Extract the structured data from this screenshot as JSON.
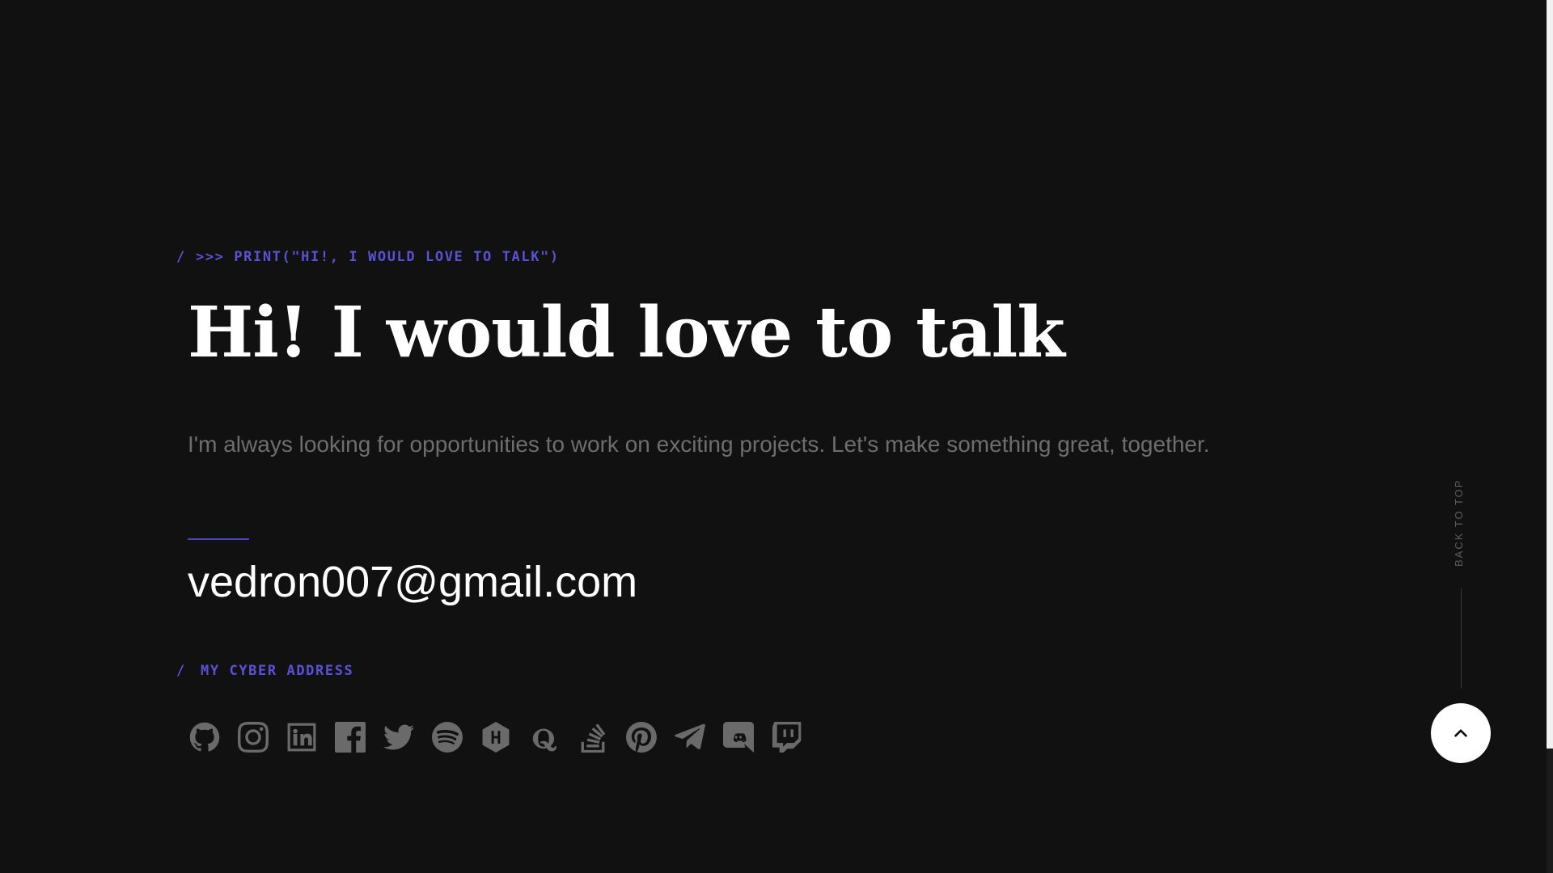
{
  "contact": {
    "eyebrow_slash": "/",
    "eyebrow_text": ">>> PRINT(\"HI!, I WOULD LOVE TO TALK\")",
    "heading": "Hi! I would love to talk",
    "lead": "I'm always looking for opportunities to work on exciting projects. Let's make something great, together.",
    "email": "vedron007@gmail.com"
  },
  "cyber": {
    "slash": "/",
    "label": "MY CYBER ADDRESS",
    "icons": [
      "github-icon",
      "instagram-icon",
      "linkedin-icon",
      "facebook-icon",
      "twitter-icon",
      "spotify-icon",
      "hashnode-icon",
      "quora-icon",
      "stackoverflow-icon",
      "pinterest-icon",
      "telegram-icon",
      "discord-icon",
      "twitch-icon"
    ]
  },
  "back_to_top": {
    "label": "BACK TO TOP",
    "icon": "chevron-up-icon"
  },
  "colors": {
    "background": "#111111",
    "accent": "#5a52d6",
    "heading": "#ffffff",
    "muted": "#6e6e6e",
    "icon": "#6a6a6a"
  }
}
